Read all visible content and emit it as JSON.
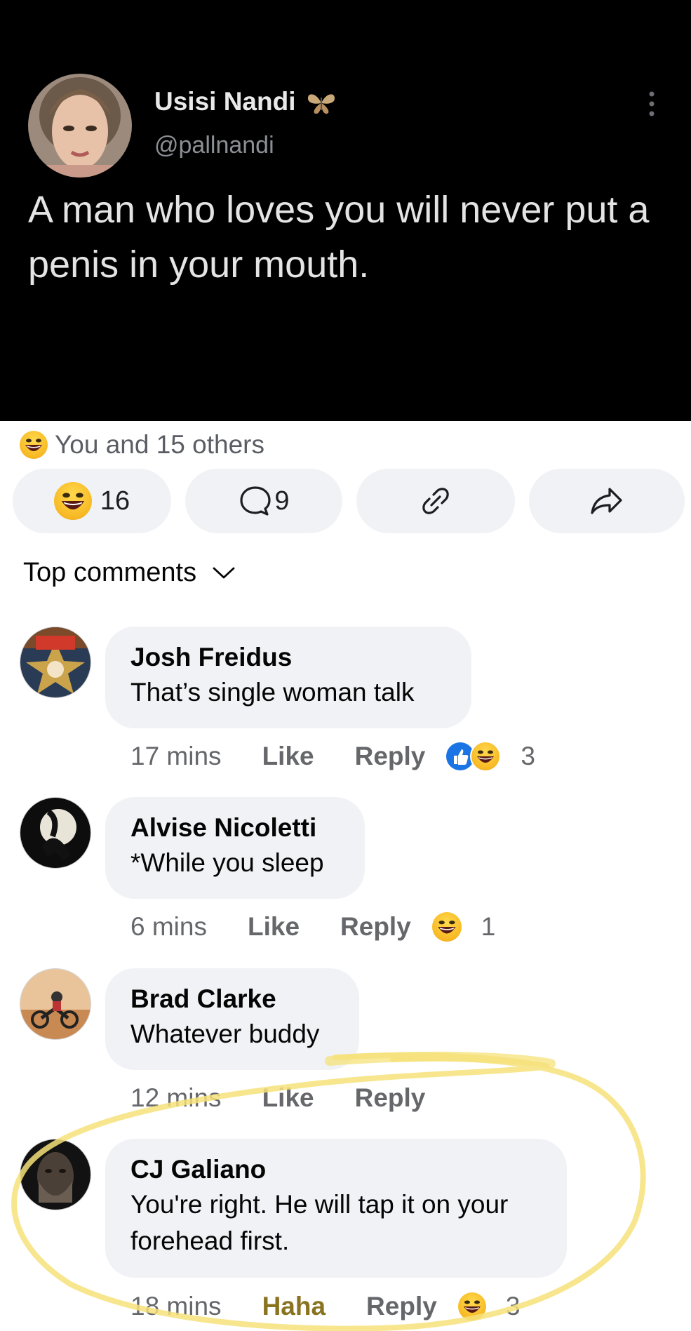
{
  "tweet": {
    "author_name": "Usisi Nandi",
    "handle": "@pallnandi",
    "text": "A man who loves you will never put a penis in your mouth."
  },
  "post": {
    "reaction_summary": "You and 15 others",
    "actions": {
      "reactions_count": "16",
      "comments_count": "9"
    },
    "top_comments_label": "Top comments"
  },
  "comments": [
    {
      "author": "Josh Freidus",
      "text": "That’s single woman talk",
      "time": "17 mins",
      "like_label": "Like",
      "reply_label": "Reply",
      "reactions": [
        "like",
        "haha"
      ],
      "reaction_count": "3"
    },
    {
      "author": "Alvise Nicoletti",
      "text": "*While you sleep",
      "time": "6 mins",
      "like_label": "Like",
      "reply_label": "Reply",
      "reactions": [
        "haha"
      ],
      "reaction_count": "1"
    },
    {
      "author": "Brad Clarke",
      "text": "Whatever buddy",
      "time": "12 mins",
      "like_label": "Like",
      "reply_label": "Reply",
      "reactions": [],
      "reaction_count": ""
    },
    {
      "author": "CJ Galiano",
      "text_line1": "You're right. He will tap it on your",
      "text_line2": "forehead first.",
      "time": "18 mins",
      "like_label": "Haha",
      "reply_label": "Reply",
      "reactions": [
        "haha"
      ],
      "reaction_count": "3"
    }
  ],
  "colors": {
    "bubble": "#f0f2f5",
    "secondary_text": "#65676b",
    "haha_active": "#8a7320",
    "highlight": "#f6e27a"
  }
}
